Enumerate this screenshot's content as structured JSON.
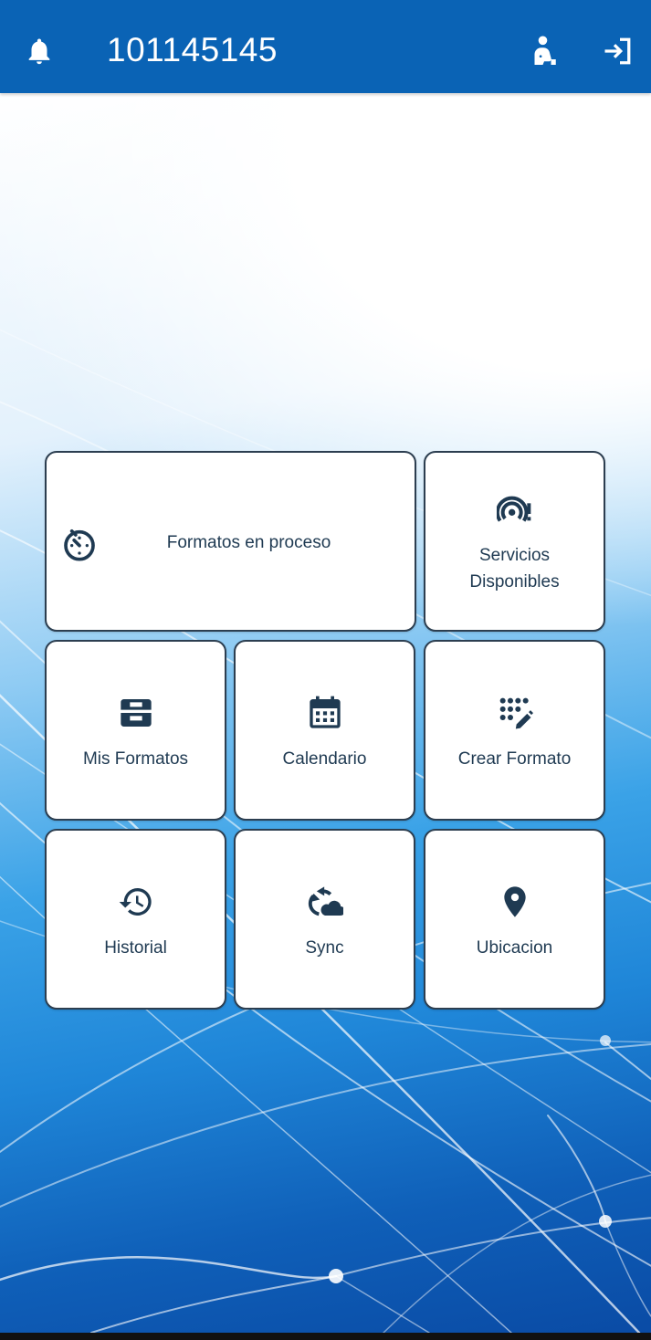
{
  "appbar": {
    "title": "101145145",
    "icons": {
      "left": "bell-icon",
      "right": [
        "profile-icon",
        "logout-icon"
      ]
    },
    "color": "#0a63b5"
  },
  "tiles": [
    {
      "id": "formatos_en_proceso",
      "label": "Formatos en proceso",
      "icon": "timer-icon"
    },
    {
      "id": "servicios_disponibles",
      "label": "Servicios Disponibles",
      "icon": "signal-alert-icon"
    },
    {
      "id": "mis_formatos",
      "label": "Mis Formatos",
      "icon": "inbox-tray-icon"
    },
    {
      "id": "calendario",
      "label": "Calendario",
      "icon": "calendar-icon"
    },
    {
      "id": "crear_formato",
      "label": "Crear Formato",
      "icon": "dots-edit-icon"
    },
    {
      "id": "historial",
      "label": "Historial",
      "icon": "history-icon"
    },
    {
      "id": "sync",
      "label": "Sync",
      "icon": "sync-cloud-icon"
    },
    {
      "id": "ubicacion",
      "label": "Ubicacion",
      "icon": "location-pin-icon"
    }
  ],
  "colors": {
    "tile_text": "#1f3a52",
    "tile_border": "#2c3e50",
    "background_accent": "#1f86d8"
  }
}
